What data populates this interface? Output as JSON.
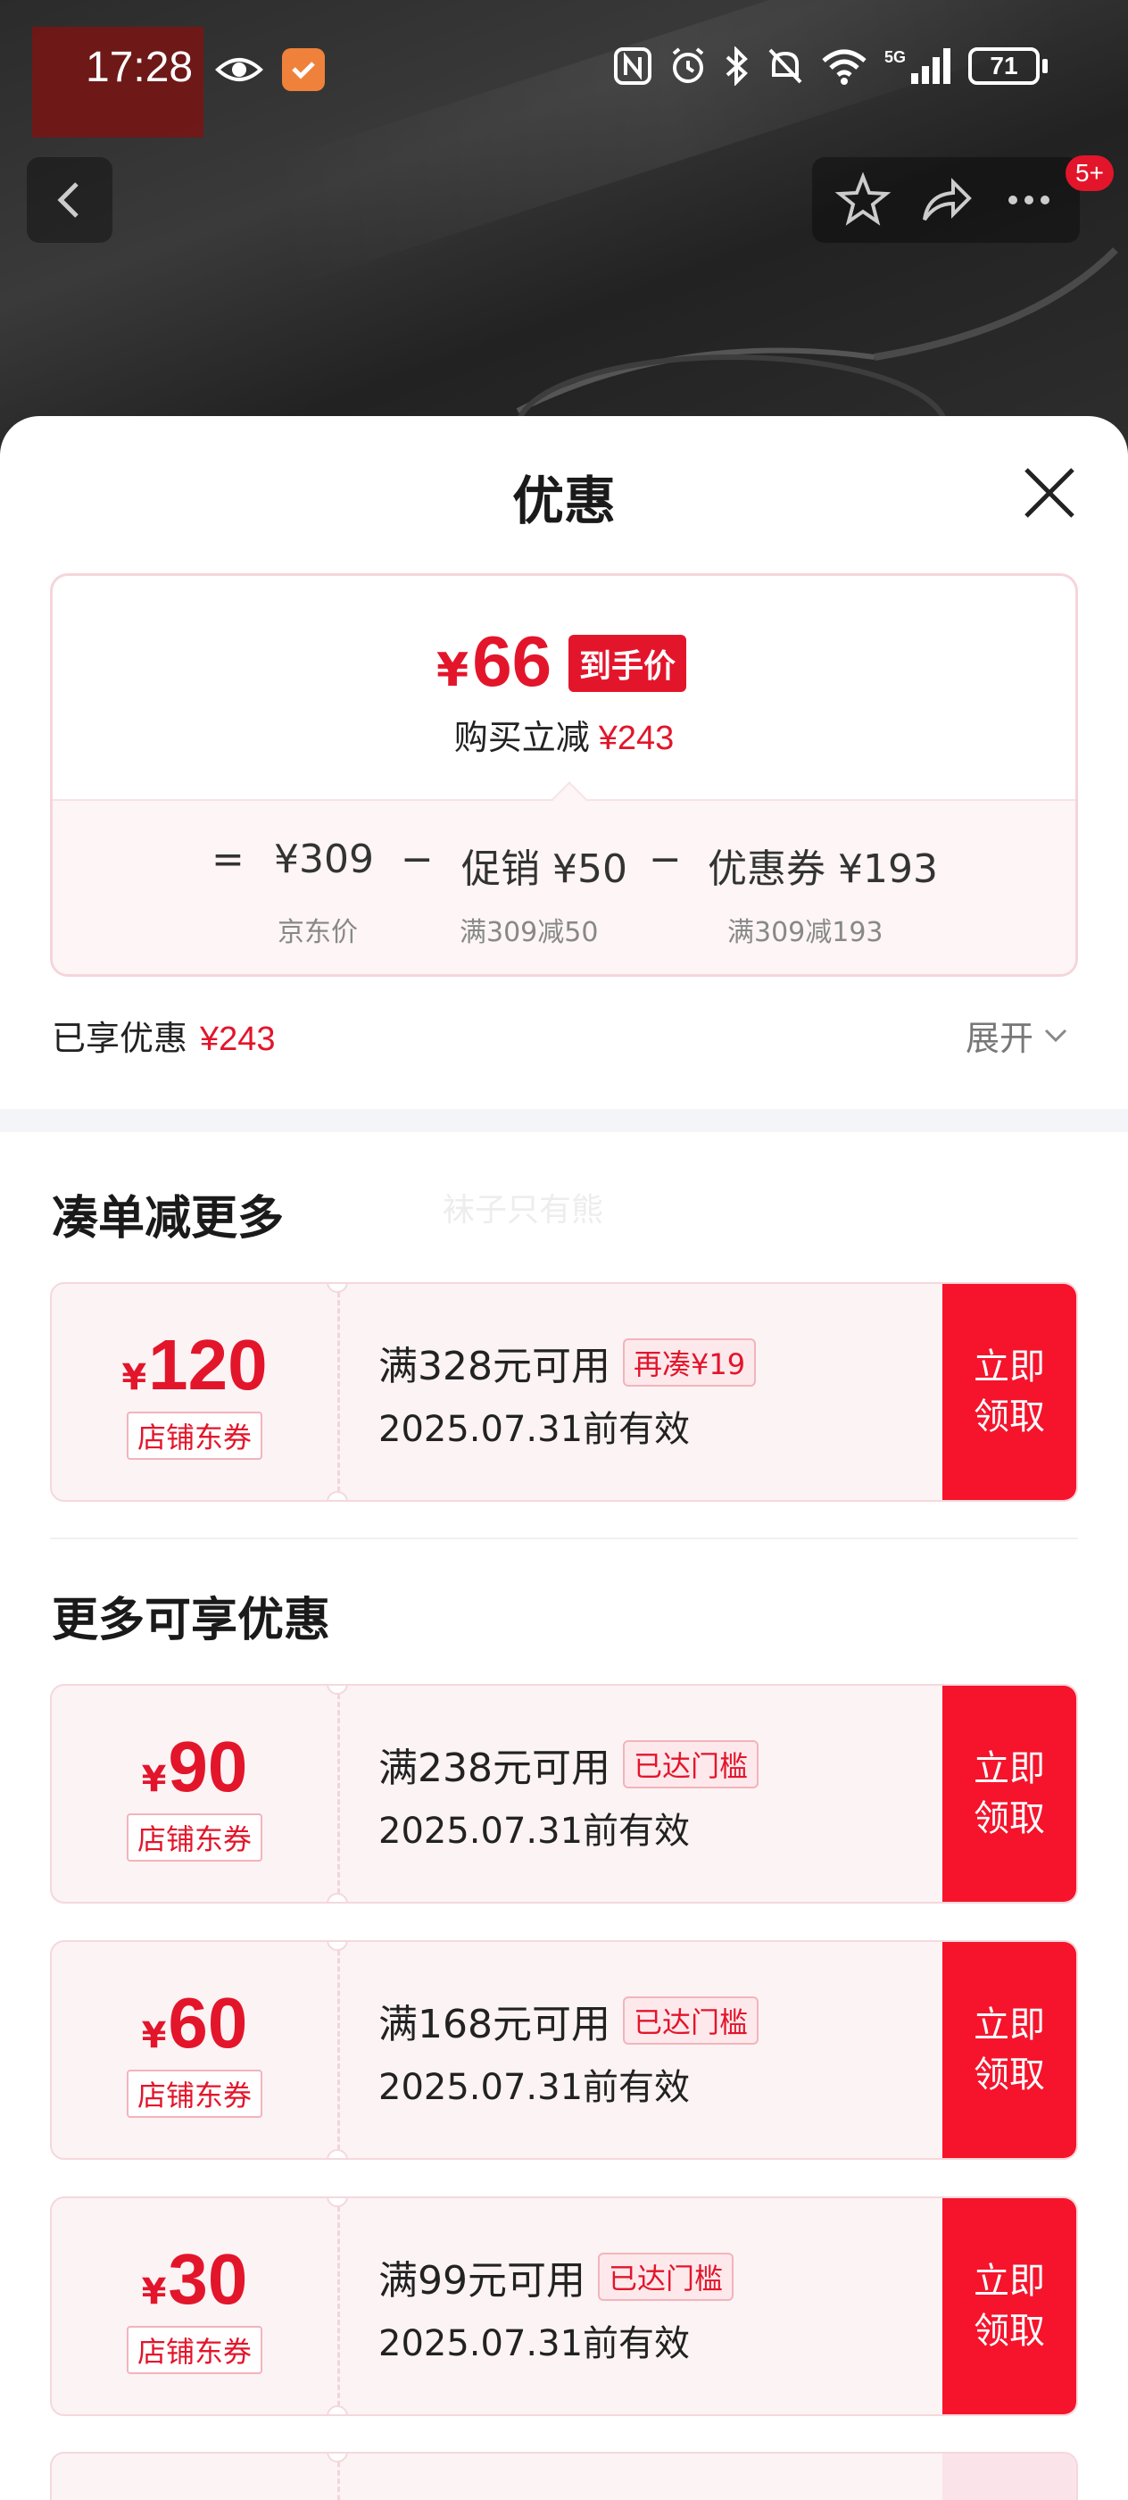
{
  "status_bar": {
    "time": "17:28",
    "battery": "71",
    "network": "5G"
  },
  "nav": {
    "cart_badge": "5+"
  },
  "sheet": {
    "title": "优惠",
    "summary": {
      "currency": "¥",
      "final_price": "66",
      "final_price_tag": "到手价",
      "instant_save_label": "购买立减",
      "instant_save_amount": "¥243",
      "formula": {
        "equals": "=",
        "base_price": "¥309",
        "base_price_caption": "京东价",
        "minus1": "−",
        "promo_label": "促销 ¥50",
        "promo_caption": "满309减50",
        "minus2": "−",
        "coupon_label": "优惠券 ¥193",
        "coupon_caption": "满309减193"
      }
    },
    "enjoyed": {
      "label": "已享优惠",
      "amount": "¥243",
      "expand_label": "展开"
    },
    "watermark_text": "袜子只有熊",
    "section_more": "凑单减更多",
    "section_available": "更多可享优惠",
    "coupons_more": [
      {
        "currency": "¥",
        "amount": "120",
        "type": "店铺东券",
        "condition": "满328元可用",
        "chip": "再凑¥19",
        "expiry": "2025.07.31前有效",
        "claim_line1": "立即",
        "claim_line2": "领取"
      }
    ],
    "coupons_available": [
      {
        "currency": "¥",
        "amount": "90",
        "type": "店铺东券",
        "condition": "满238元可用",
        "chip": "已达门槛",
        "expiry": "2025.07.31前有效",
        "claim_line1": "立即",
        "claim_line2": "领取"
      },
      {
        "currency": "¥",
        "amount": "60",
        "type": "店铺东券",
        "condition": "满168元可用",
        "chip": "已达门槛",
        "expiry": "2025.07.31前有效",
        "claim_line1": "立即",
        "claim_line2": "领取"
      },
      {
        "currency": "¥",
        "amount": "30",
        "type": "店铺东券",
        "condition": "满99元可用",
        "chip": "已达门槛",
        "expiry": "2025.07.31前有效",
        "claim_line1": "立即",
        "claim_line2": "领取"
      }
    ]
  },
  "colors": {
    "accent_red": "#e3152b",
    "claim_red": "#f5142c",
    "coupon_bg": "#fcf3f4"
  },
  "icons": [
    "eye-icon",
    "app-badge-icon",
    "nfc-icon",
    "alarm-icon",
    "bluetooth-icon",
    "mute-icon",
    "wifi-icon",
    "signal-icon",
    "battery-icon",
    "back-icon",
    "star-icon",
    "share-icon",
    "more-icon",
    "close-icon",
    "chevron-down-icon"
  ]
}
